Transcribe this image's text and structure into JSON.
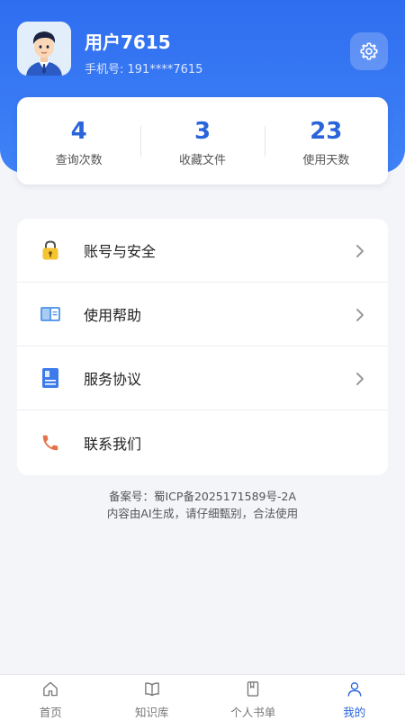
{
  "profile": {
    "username": "用户7615",
    "phone": "手机号: 191****7615",
    "avatar": "cartoon-man-avatar"
  },
  "stats": [
    {
      "value": "4",
      "label": "查询次数"
    },
    {
      "value": "3",
      "label": "收藏文件"
    },
    {
      "value": "23",
      "label": "使用天数"
    }
  ],
  "menu": [
    {
      "label": "账号与安全",
      "icon": "lock-icon",
      "has_chevron": true
    },
    {
      "label": "使用帮助",
      "icon": "book-icon",
      "has_chevron": true
    },
    {
      "label": "服务协议",
      "icon": "document-icon",
      "has_chevron": true
    },
    {
      "label": "联系我们",
      "icon": "phone-icon",
      "has_chevron": false
    }
  ],
  "footer": {
    "icp": "备案号：蜀ICP备2025171589号-2A",
    "disclaimer": "内容由AI生成，请仔细甄别，合法使用"
  },
  "tabs": [
    {
      "label": "首页",
      "icon": "home-icon",
      "active": false
    },
    {
      "label": "知识库",
      "icon": "open-book-icon",
      "active": false
    },
    {
      "label": "个人书单",
      "icon": "bookmark-book-icon",
      "active": false
    },
    {
      "label": "我的",
      "icon": "user-icon",
      "active": true
    }
  ],
  "colors": {
    "primary": "#2f6ef0",
    "accent_text": "#2a64db",
    "background": "#f4f5f9"
  }
}
